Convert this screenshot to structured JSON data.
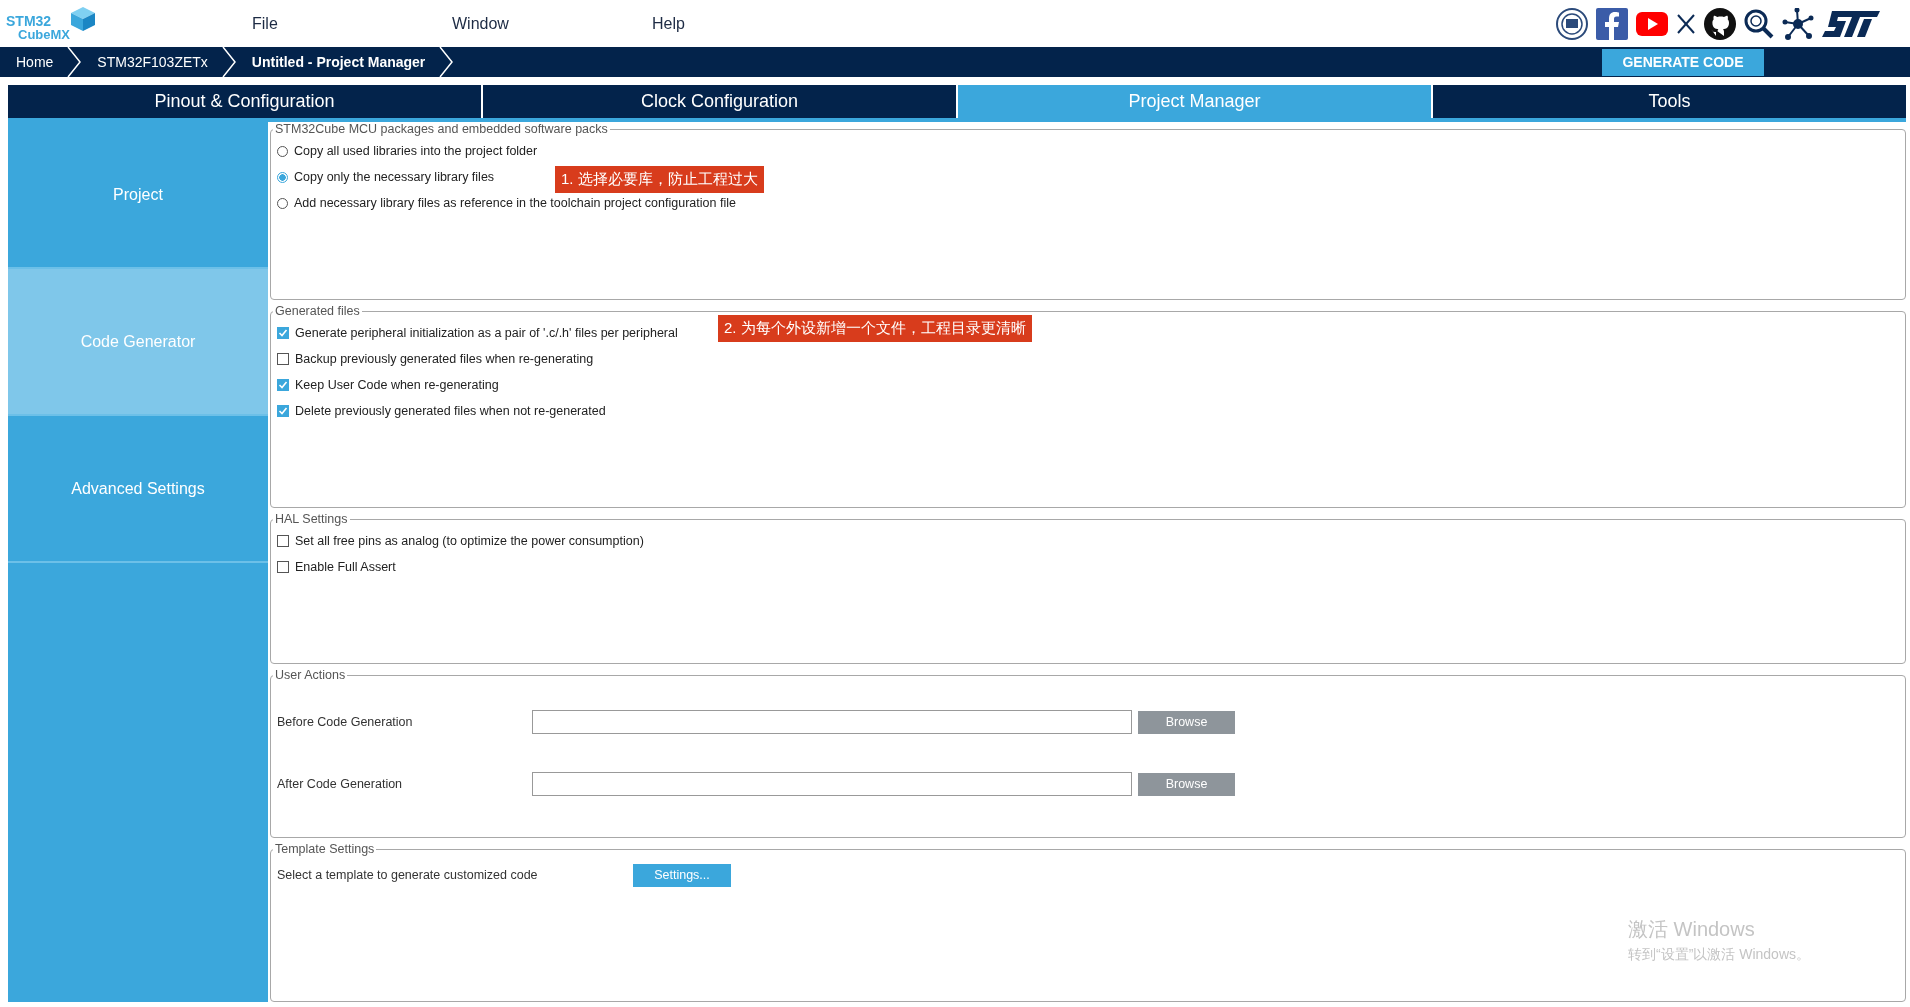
{
  "logo": {
    "line1": "STM32",
    "line2": "CubeMX"
  },
  "menu": [
    {
      "label": "File"
    },
    {
      "label": "Window"
    },
    {
      "label": "Help"
    }
  ],
  "breadcrumbs": [
    {
      "label": "Home",
      "current": false
    },
    {
      "label": "STM32F103ZETx",
      "current": false
    },
    {
      "label": "Untitled - Project Manager",
      "current": true
    }
  ],
  "generate_button": "GENERATE CODE",
  "tabs": [
    {
      "label": "Pinout & Configuration",
      "selected": false
    },
    {
      "label": "Clock Configuration",
      "selected": false
    },
    {
      "label": "Project Manager",
      "selected": true
    },
    {
      "label": "Tools",
      "selected": false
    }
  ],
  "sidebar": {
    "items": [
      {
        "label": "Project",
        "selected": false
      },
      {
        "label": "Code Generator",
        "selected": true
      },
      {
        "label": "Advanced Settings",
        "selected": false
      }
    ]
  },
  "groups": [
    {
      "kind": "options",
      "title": "STM32Cube MCU packages and embedded software packs",
      "items": [
        {
          "kind": "radio",
          "label": "Copy all used libraries into the project folder",
          "selected": false
        },
        {
          "kind": "radio",
          "label": "Copy only the necessary library files",
          "selected": true
        },
        {
          "kind": "radio",
          "label": "Add necessary library files as reference in the toolchain project configuration file",
          "selected": false
        }
      ]
    },
    {
      "kind": "options",
      "title": "Generated files",
      "items": [
        {
          "kind": "checkbox",
          "label": "Generate peripheral initialization as a pair of '.c/.h' files per peripheral",
          "checked": true
        },
        {
          "kind": "checkbox",
          "label": "Backup previously generated files when re-generating",
          "checked": false
        },
        {
          "kind": "checkbox",
          "label": "Keep User Code when re-generating",
          "checked": true
        },
        {
          "kind": "checkbox",
          "label": "Delete previously generated files when not re-generated",
          "checked": true
        }
      ]
    },
    {
      "kind": "options",
      "title": "HAL Settings",
      "items": [
        {
          "kind": "checkbox",
          "label": "Set all free pins as analog (to optimize the power consumption)",
          "checked": false
        },
        {
          "kind": "checkbox",
          "label": "Enable Full Assert",
          "checked": false
        }
      ]
    },
    {
      "kind": "fields",
      "title": "User Actions",
      "rows": [
        {
          "label": "Before Code Generation",
          "button": "Browse"
        },
        {
          "label": "After Code Generation",
          "button": "Browse"
        }
      ]
    },
    {
      "kind": "template",
      "title": "Template Settings",
      "label": "Select a template to generate customized code",
      "button": "Settings..."
    }
  ],
  "annotations": [
    {
      "text": "1. 选择必要库，防止工程过大"
    },
    {
      "text": "2. 为每个外设新增一个文件，工程目录更清晰"
    }
  ],
  "os_notice": {
    "title": "激活 Windows",
    "subtitle": "转到“设置”以激活 Windows。"
  }
}
